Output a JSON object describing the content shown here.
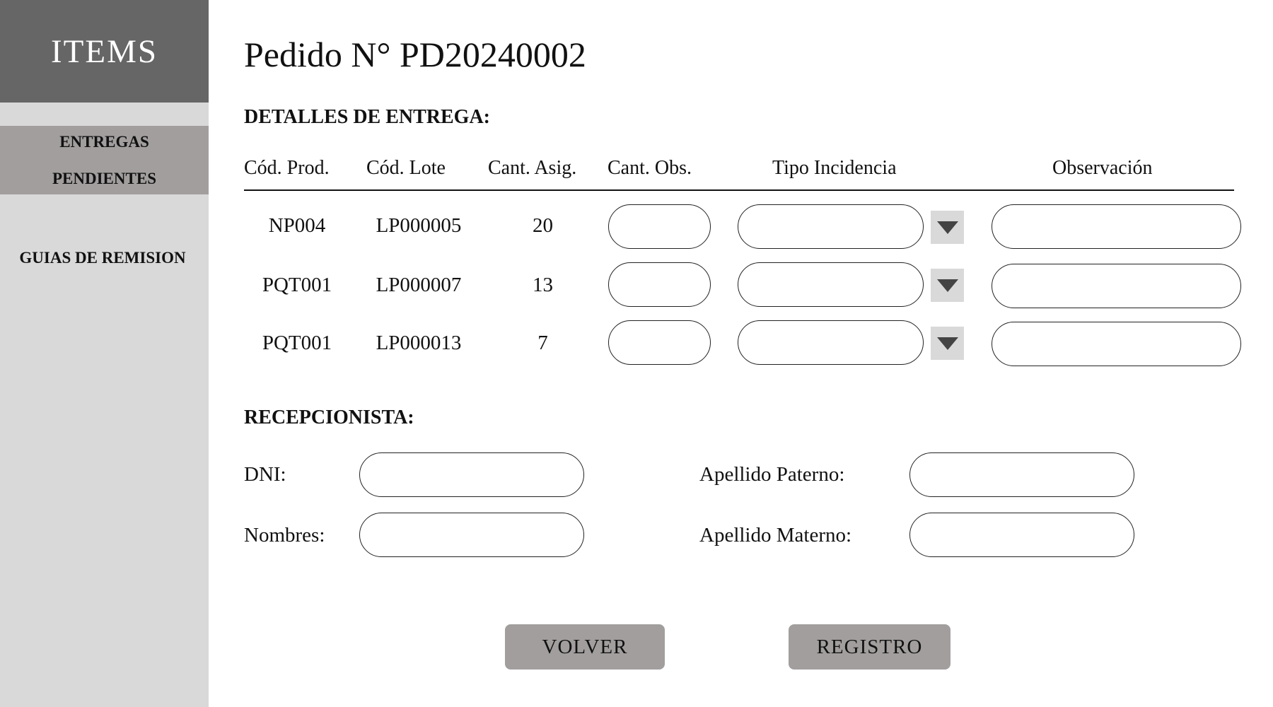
{
  "sidebar": {
    "brand": "ITEMS",
    "items": [
      {
        "line1": "ENTREGAS",
        "line2": "PENDIENTES"
      },
      {
        "label": "GUIAS DE REMISION"
      }
    ]
  },
  "page": {
    "title": "Pedido N° PD20240002",
    "delivery_section": "DETALLES DE ENTREGA:",
    "receptionist_section": "RECEPCIONISTA:"
  },
  "table": {
    "headers": [
      "Cód. Prod.",
      "Cód. Lote",
      "Cant. Asig.",
      "Cant. Obs.",
      "Tipo Incidencia",
      "Observación"
    ],
    "rows": [
      {
        "cod_prod": "NP004",
        "cod_lote": "LP000005",
        "cant_asig": "20",
        "cant_obs": "",
        "tipo_incidencia": "",
        "observacion": ""
      },
      {
        "cod_prod": "PQT001",
        "cod_lote": "LP000007",
        "cant_asig": "13",
        "cant_obs": "",
        "tipo_incidencia": "",
        "observacion": ""
      },
      {
        "cod_prod": "PQT001",
        "cod_lote": "LP000013",
        "cant_asig": "7",
        "cant_obs": "",
        "tipo_incidencia": "",
        "observacion": ""
      }
    ]
  },
  "receptionist": {
    "dni_label": "DNI:",
    "dni_value": "",
    "nombres_label": "Nombres:",
    "nombres_value": "",
    "apellido_paterno_label": "Apellido Paterno:",
    "apellido_paterno_value": "",
    "apellido_materno_label": "Apellido Materno:",
    "apellido_materno_value": ""
  },
  "buttons": {
    "back": "VOLVER",
    "register": "REGISTRO"
  },
  "icons": {
    "dropdown": "caret-down-icon"
  },
  "colors": {
    "brand_bg": "#666666",
    "sidebar_bg": "#d9d9d9",
    "active_item_bg": "#a29e9e",
    "button_bg": "#a29e9e"
  }
}
